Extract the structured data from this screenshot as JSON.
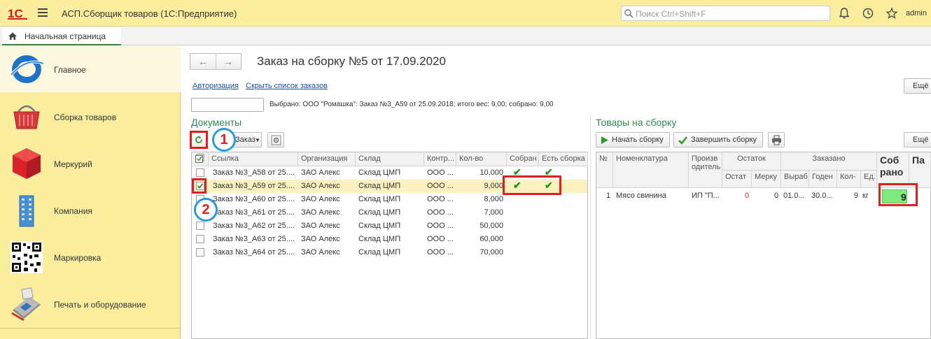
{
  "app": {
    "logo_text": "1С",
    "title": "АСП.Сборщик товаров  (1С:Предприятие)",
    "search_placeholder": "Поиск Ctrl+Shift+F",
    "user": "admin"
  },
  "tabs": {
    "home_label": "Начальная страница"
  },
  "sidebar": {
    "items": [
      {
        "label": "Главное",
        "icon": "main-section-icon"
      },
      {
        "label": "Сборка товаров",
        "icon": "shopping-basket-icon"
      },
      {
        "label": "Меркурий",
        "icon": "red-cube-icon"
      },
      {
        "label": "Компания",
        "icon": "building-icon"
      },
      {
        "label": "Маркировка",
        "icon": "qr-code-icon"
      },
      {
        "label": "Печать и оборудование",
        "icon": "payment-terminal-icon"
      }
    ]
  },
  "main": {
    "title": "Заказ на сборку №5 от 17.09.2020",
    "links": {
      "auth": "Авторизация",
      "hide_orders": "Скрыть список заказов"
    },
    "more_label": "Ещё",
    "selected_info": "Выбрано: ООО \"Ромашка\": Заказ №3_А59 от 25.09.2018; итого вес: 9,00; собрано: 9,00"
  },
  "documents": {
    "title": "Документы",
    "order_button": "Заказ",
    "columns": [
      "Ссылка",
      "Организация",
      "Склад",
      "Контр...",
      "Кол-во",
      "Собран",
      "Есть сборка"
    ],
    "rows": [
      {
        "ref": "Заказ №3_А58 от 25....",
        "org": "ЗАО Алекс",
        "store": "Склад ЦМП",
        "contr": "ООО ...",
        "qty": "10,000",
        "collected": true,
        "has_build": true,
        "checked": false
      },
      {
        "ref": "Заказ №3_А59 от 25....",
        "org": "ЗАО Алекс",
        "store": "Склад ЦМП",
        "contr": "ООО ...",
        "qty": "9,000",
        "collected": true,
        "has_build": true,
        "checked": true
      },
      {
        "ref": "Заказ №3_А60 от 25....",
        "org": "ЗАО Алекс",
        "store": "Склад ЦМП",
        "contr": "ООО ...",
        "qty": "8,000",
        "collected": false,
        "has_build": false,
        "checked": false
      },
      {
        "ref": "Заказ №3_А61 от 25....",
        "org": "ЗАО Алекс",
        "store": "Склад ЦМП",
        "contr": "ООО ...",
        "qty": "7,000",
        "collected": false,
        "has_build": false,
        "checked": false
      },
      {
        "ref": "Заказ №3_А62 от 25....",
        "org": "ЗАО Алекс",
        "store": "Склад ЦМП",
        "contr": "ООО ...",
        "qty": "50,000",
        "collected": false,
        "has_build": false,
        "checked": false
      },
      {
        "ref": "Заказ №3_А63 от 25....",
        "org": "ЗАО Алекс",
        "store": "Склад ЦМП",
        "contr": "ООО ...",
        "qty": "60,000",
        "collected": false,
        "has_build": false,
        "checked": false
      },
      {
        "ref": "Заказ №3_А64 от 25....",
        "org": "ЗАО Алекс",
        "store": "Склад ЦМП",
        "contr": "ООО ...",
        "qty": "70,000",
        "collected": false,
        "has_build": false,
        "checked": false
      }
    ]
  },
  "goods": {
    "title": "Товары на сборку",
    "start_button": "Начать сборку",
    "finish_button": "Завершить сборку",
    "headers": {
      "num": "№",
      "item": "Номенклатура",
      "producer": "Произв одитель",
      "stock": "Остаток",
      "stock_rest": "Остат",
      "stock_merc": "Мерку",
      "ordered": "Заказано",
      "made": "Выраб",
      "valid": "Годен",
      "qty": "Кол-",
      "unit": "Ед.",
      "collected": "Соб рано",
      "pa": "Па"
    },
    "rows": [
      {
        "num": "1",
        "item": "Мясо свинина",
        "producer": "ИП \"П...",
        "rest": "0",
        "merc": "0",
        "made": "01.0...",
        "valid": "30.0...",
        "qty": "9",
        "unit": "кг",
        "collected": "9"
      }
    ]
  },
  "annotations": {
    "marker_1": "1",
    "marker_2": "2"
  },
  "colors": {
    "topbar": "#fbed9e",
    "sidebar": "#fbed9e",
    "accent_green": "#2e8b57",
    "highlight_red": "#e02020",
    "marker_blue": "#2a9ad8",
    "collected_cell": "#7fe87f"
  }
}
